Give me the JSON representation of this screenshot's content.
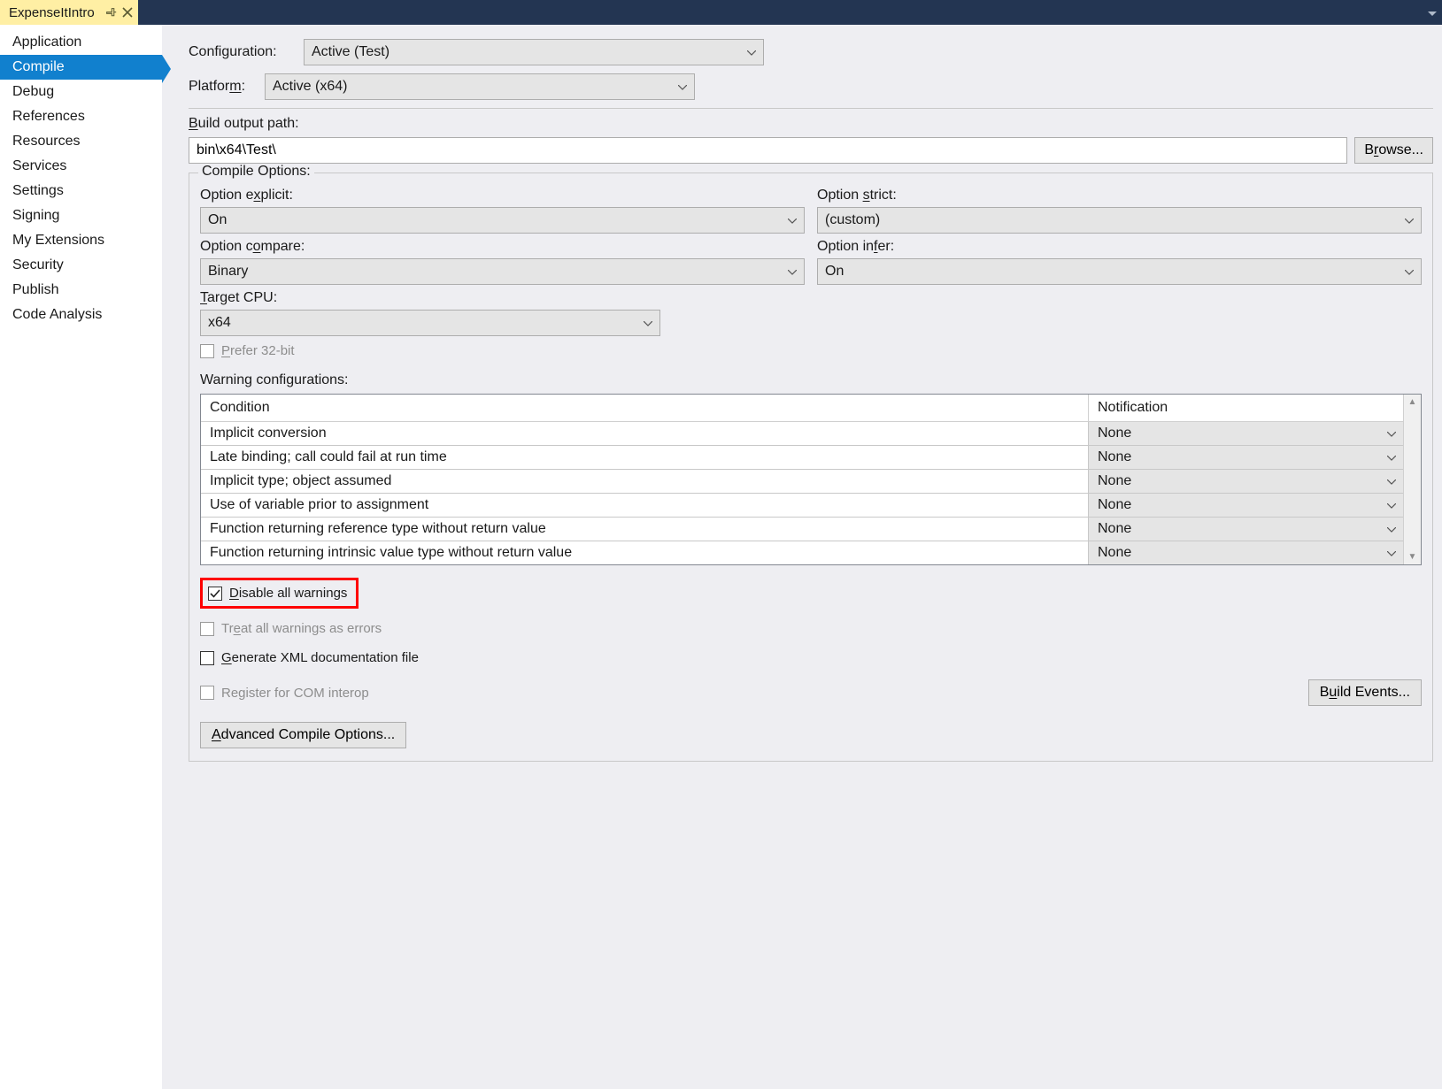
{
  "tab": {
    "title": "ExpenseItIntro"
  },
  "sidebar": {
    "items": [
      "Application",
      "Compile",
      "Debug",
      "References",
      "Resources",
      "Services",
      "Settings",
      "Signing",
      "My Extensions",
      "Security",
      "Publish",
      "Code Analysis"
    ],
    "selectedIndex": 1
  },
  "config": {
    "configurationLabel": "Configuration:",
    "configurationValue": "Active (Test)",
    "platformLabel": "Platform:",
    "platformValue": "Active (x64)"
  },
  "buildOutput": {
    "label": "Build output path:",
    "value": "bin\\x64\\Test\\",
    "browse": "Browse..."
  },
  "compileOptions": {
    "legend": "Compile Options:",
    "optionExplicitLabel": "Option explicit:",
    "optionExplicitValue": "On",
    "optionStrictLabel": "Option strict:",
    "optionStrictValue": "(custom)",
    "optionCompareLabel": "Option compare:",
    "optionCompareValue": "Binary",
    "optionInferLabel": "Option infer:",
    "optionInferValue": "On",
    "targetCpuLabel": "Target CPU:",
    "targetCpuValue": "x64",
    "prefer32Label": "Prefer 32-bit",
    "warnConfigLabel": "Warning configurations:",
    "headers": {
      "condition": "Condition",
      "notification": "Notification"
    },
    "rows": [
      {
        "cond": "Implicit conversion",
        "not": "None"
      },
      {
        "cond": "Late binding; call could fail at run time",
        "not": "None"
      },
      {
        "cond": "Implicit type; object assumed",
        "not": "None"
      },
      {
        "cond": "Use of variable prior to assignment",
        "not": "None"
      },
      {
        "cond": "Function returning reference type without return value",
        "not": "None"
      },
      {
        "cond": "Function returning intrinsic value type without return value",
        "not": "None"
      }
    ],
    "disableAll": "Disable all warnings",
    "treatAll": "Treat all warnings as errors",
    "genXml": "Generate XML documentation file",
    "registerCom": "Register for COM interop",
    "buildEvents": "Build Events...",
    "advanced": "Advanced Compile Options..."
  }
}
